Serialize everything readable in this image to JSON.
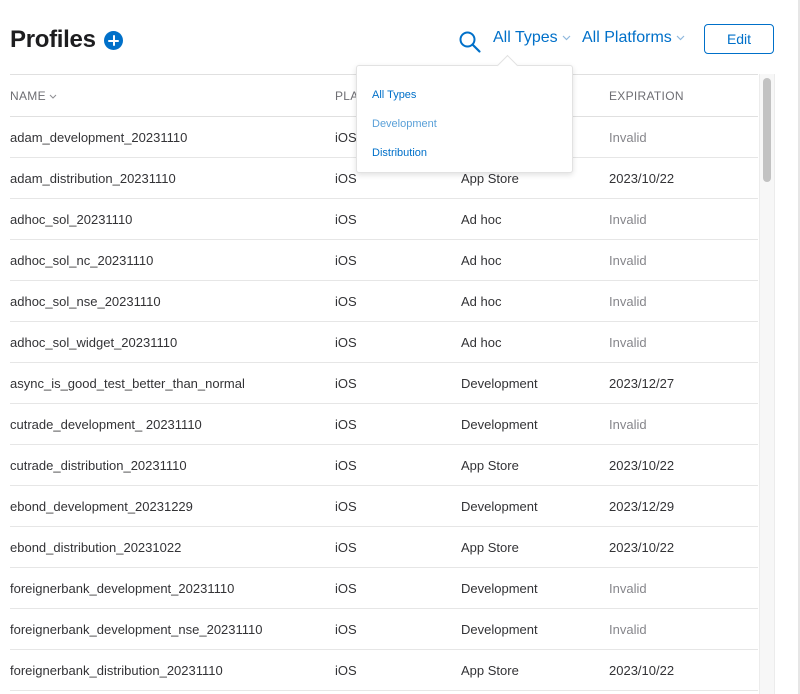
{
  "header": {
    "title": "Profiles",
    "filter_types": "All Types",
    "filter_platforms": "All Platforms",
    "edit_label": "Edit"
  },
  "icons": {
    "add": "plus-circle-icon",
    "search": "search-icon",
    "chevron": "chevron-down-icon"
  },
  "colors": {
    "accent": "#0070c9",
    "text": "#333336",
    "muted": "#86868b"
  },
  "columns": {
    "name": "NAME",
    "platform": "PLA",
    "expiration": "EXPIRATION"
  },
  "dropdown": {
    "items": [
      "All Types",
      "Development",
      "Distribution"
    ]
  },
  "rows": [
    {
      "name": "adam_development_20231110",
      "platform": "iOS",
      "type": "",
      "expiration": "Invalid",
      "invalid": true
    },
    {
      "name": "adam_distribution_20231110",
      "platform": "iOS",
      "type": "App Store",
      "expiration": "2023/10/22",
      "invalid": false
    },
    {
      "name": "adhoc_sol_20231110",
      "platform": "iOS",
      "type": "Ad hoc",
      "expiration": "Invalid",
      "invalid": true
    },
    {
      "name": "adhoc_sol_nc_20231110",
      "platform": "iOS",
      "type": "Ad hoc",
      "expiration": "Invalid",
      "invalid": true
    },
    {
      "name": "adhoc_sol_nse_20231110",
      "platform": "iOS",
      "type": "Ad hoc",
      "expiration": "Invalid",
      "invalid": true
    },
    {
      "name": "adhoc_sol_widget_20231110",
      "platform": "iOS",
      "type": "Ad hoc",
      "expiration": "Invalid",
      "invalid": true
    },
    {
      "name": "async_is_good_test_better_than_normal",
      "platform": "iOS",
      "type": "Development",
      "expiration": "2023/12/27",
      "invalid": false
    },
    {
      "name": "cutrade_development_ 20231110",
      "platform": "iOS",
      "type": "Development",
      "expiration": "Invalid",
      "invalid": true
    },
    {
      "name": "cutrade_distribution_20231110",
      "platform": "iOS",
      "type": "App Store",
      "expiration": "2023/10/22",
      "invalid": false
    },
    {
      "name": "ebond_development_20231229",
      "platform": "iOS",
      "type": "Development",
      "expiration": "2023/12/29",
      "invalid": false
    },
    {
      "name": "ebond_distribution_20231022",
      "platform": "iOS",
      "type": "App Store",
      "expiration": "2023/10/22",
      "invalid": false
    },
    {
      "name": "foreignerbank_development_20231110",
      "platform": "iOS",
      "type": "Development",
      "expiration": "Invalid",
      "invalid": true
    },
    {
      "name": "foreignerbank_development_nse_20231110",
      "platform": "iOS",
      "type": "Development",
      "expiration": "Invalid",
      "invalid": true
    },
    {
      "name": "foreignerbank_distribution_20231110",
      "platform": "iOS",
      "type": "App Store",
      "expiration": "2023/10/22",
      "invalid": false
    }
  ]
}
